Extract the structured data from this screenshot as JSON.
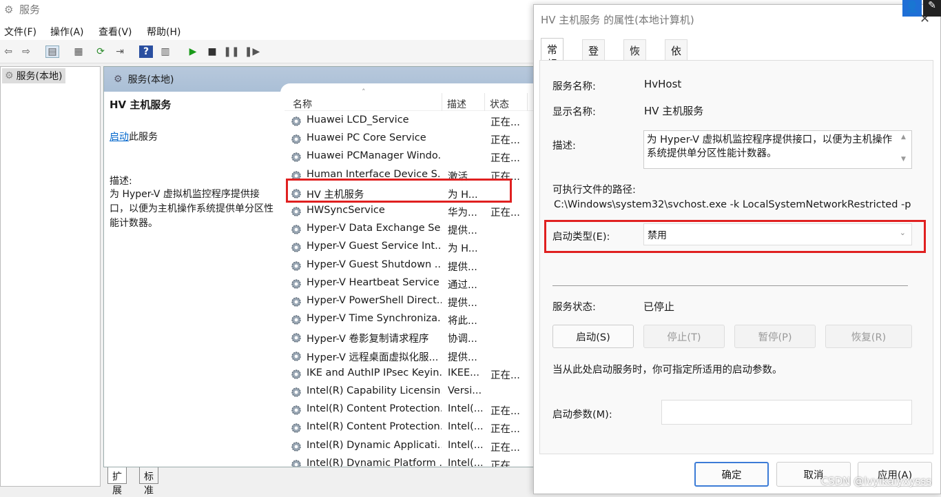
{
  "window": {
    "title": "服务"
  },
  "menu": [
    "文件(F)",
    "操作(A)",
    "查看(V)",
    "帮助(H)"
  ],
  "tree": {
    "root": "服务(本地)"
  },
  "panel": {
    "header": "服务(本地)",
    "service_title": "HV 主机服务",
    "start_link": "启动",
    "start_suffix": "此服务",
    "desc_label": "描述:",
    "desc_text": "为 Hyper-V 虚拟机监控程序提供接口，以便为主机操作系统提供单分区性能计数器。"
  },
  "list": {
    "columns": [
      "名称",
      "描述",
      "状态"
    ],
    "rows": [
      {
        "name": "Huawei LCD_Service",
        "desc": "",
        "status": "正在..."
      },
      {
        "name": "Huawei PC Core Service",
        "desc": "",
        "status": "正在..."
      },
      {
        "name": "Huawei PCManager Windo...",
        "desc": "",
        "status": "正在..."
      },
      {
        "name": "Human Interface Device S...",
        "desc": "激活...",
        "status": "正在..."
      },
      {
        "name": "HV 主机服务",
        "desc": "为 H...",
        "status": ""
      },
      {
        "name": "HWSyncService",
        "desc": "华为...",
        "status": "正在..."
      },
      {
        "name": "Hyper-V Data Exchange Se...",
        "desc": "提供...",
        "status": ""
      },
      {
        "name": "Hyper-V Guest Service Int...",
        "desc": "为 H...",
        "status": ""
      },
      {
        "name": "Hyper-V Guest Shutdown ...",
        "desc": "提供...",
        "status": ""
      },
      {
        "name": "Hyper-V Heartbeat Service",
        "desc": "通过...",
        "status": ""
      },
      {
        "name": "Hyper-V PowerShell Direct...",
        "desc": "提供...",
        "status": ""
      },
      {
        "name": "Hyper-V Time Synchroniza...",
        "desc": "将此...",
        "status": ""
      },
      {
        "name": "Hyper-V 卷影复制请求程序",
        "desc": "协调...",
        "status": ""
      },
      {
        "name": "Hyper-V 远程桌面虚拟化服...",
        "desc": "提供...",
        "status": ""
      },
      {
        "name": "IKE and AuthIP IPsec Keyin...",
        "desc": "IKEE...",
        "status": "正在..."
      },
      {
        "name": "Intel(R) Capability Licensin...",
        "desc": "Versi...",
        "status": ""
      },
      {
        "name": "Intel(R) Content Protection...",
        "desc": "Intel(...",
        "status": "正在..."
      },
      {
        "name": "Intel(R) Content Protection...",
        "desc": "Intel(...",
        "status": "正在..."
      },
      {
        "name": "Intel(R) Dynamic Applicati...",
        "desc": "Intel(...",
        "status": "正在..."
      },
      {
        "name": "Intel(R) Dynamic Platform ...",
        "desc": "Intel(...",
        "status": "正在..."
      }
    ]
  },
  "bottom_tabs": [
    "扩展",
    "标准"
  ],
  "dialog": {
    "title": "HV 主机服务 的属性(本地计算机)",
    "tabs": [
      "常规",
      "登录",
      "恢复",
      "依存关系"
    ],
    "service_name_label": "服务名称:",
    "service_name": "HvHost",
    "display_name_label": "显示名称:",
    "display_name": "HV 主机服务",
    "desc_label": "描述:",
    "desc_text": "为 Hyper-V 虚拟机监控程序提供接口，以便为主机操作系统提供单分区性能计数器。",
    "path_label": "可执行文件的路径:",
    "path": "C:\\Windows\\system32\\svchost.exe -k LocalSystemNetworkRestricted -p",
    "startup_type_label": "启动类型(E):",
    "startup_type": "禁用",
    "status_label": "服务状态:",
    "status": "已停止",
    "buttons": {
      "start": "启动(S)",
      "stop": "停止(T)",
      "pause": "暂停(P)",
      "resume": "恢复(R)"
    },
    "hint": "当从此处启动服务时，你可指定所适用的启动参数。",
    "params_label": "启动参数(M):",
    "params_value": "",
    "ok": "确定",
    "cancel": "取消",
    "apply": "应用(A)"
  },
  "watermark": "CSDN @lvyikaiyxysss",
  "colors": {
    "highlight": "#e02020",
    "link": "#0066cc"
  }
}
